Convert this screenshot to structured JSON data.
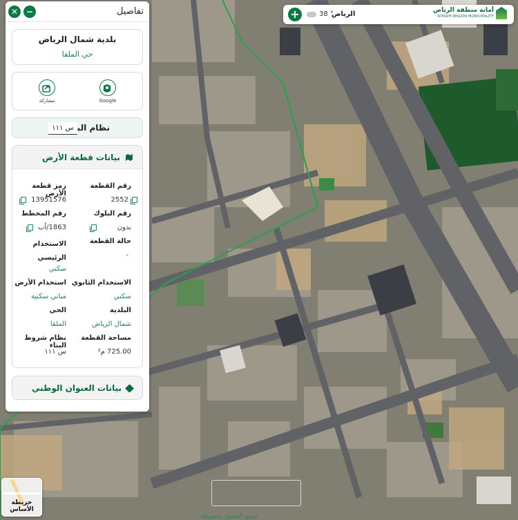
{
  "topbar": {
    "city": "الرياض",
    "temperature": "38 °",
    "logo_ar": "أمانة منطقة الرياض",
    "logo_en": "RIYADH REGION MUNICIPALITY",
    "icons": {
      "add": "plus-icon",
      "weather": "cloud-icon",
      "logo": "logo-mark-icon"
    }
  },
  "panel": {
    "title": "تفاصيل",
    "close_icon": "close-icon",
    "minimize_icon": "minus-icon",
    "municipality": {
      "title": "بلدية شمال الرياض",
      "district": "حي الملقا"
    },
    "actions": [
      {
        "label": "Google",
        "icon": "map-pin-icon"
      },
      {
        "label": "مشاركة",
        "icon": "share-icon"
      }
    ],
    "building_system": {
      "label": "نظام البناء",
      "value": "س ١١١"
    },
    "plot": {
      "header": "بيانات قطعة الأرض",
      "fields": [
        {
          "key": "رقم القطعة",
          "value": "2552",
          "copy": true
        },
        {
          "key": "رمز قطعة الأرض",
          "value": "13951576",
          "copy": true
        },
        {
          "key": "رقم البلوك",
          "value": "بدون",
          "copy": true
        },
        {
          "key": "رقم المخطط",
          "value": "1863/أب",
          "copy": true
        },
        {
          "key": "حالة القطعة",
          "value": "-"
        },
        {
          "key": "الاستخدام الرئيسي",
          "value": "سكني"
        },
        {
          "key": "الاستخدام الثانوي",
          "value": "سكني"
        },
        {
          "key": "استخدام الأرض",
          "value": "مباني سكنية"
        },
        {
          "key": "البلدية",
          "value": "شمال الرياض"
        },
        {
          "key": "الحي",
          "value": "الملقا"
        },
        {
          "key": "مساحة القطعة",
          "value": "725.00 م²"
        },
        {
          "key": "نظام شروط البناء",
          "value": "س ١١١"
        }
      ]
    },
    "address": {
      "header": "بيانات العنوان الوطني"
    }
  },
  "basemap": {
    "label": "خريطة الأساس"
  },
  "copyright": "جميع الحقوق محفوظة"
}
